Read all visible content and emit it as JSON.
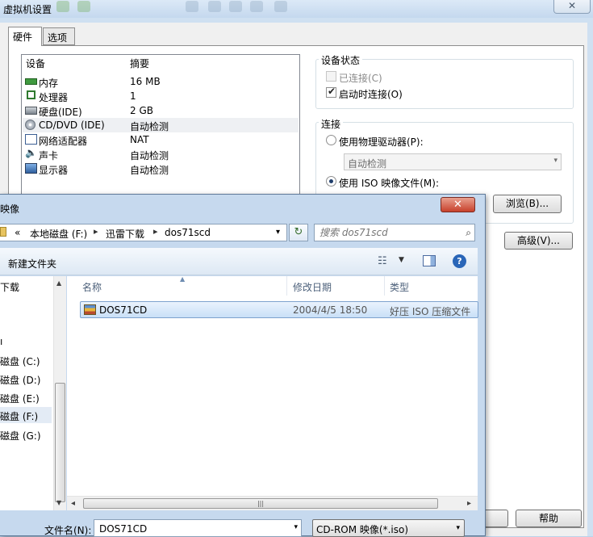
{
  "vm_window": {
    "title": "虚拟机设置",
    "close_glyph": "✕",
    "tabs": [
      {
        "label": "硬件"
      },
      {
        "label": "选项"
      }
    ],
    "device_list": {
      "headers": {
        "device": "设备",
        "summary": "摘要"
      },
      "rows": [
        {
          "name": "内存",
          "summary": "16 MB",
          "icon": "memory-icon"
        },
        {
          "name": "处理器",
          "summary": "1",
          "icon": "processor-icon"
        },
        {
          "name": "硬盘(IDE)",
          "summary": "2 GB",
          "icon": "harddisk-icon"
        },
        {
          "name": "CD/DVD (IDE)",
          "summary": "自动检测",
          "icon": "cdrom-icon"
        },
        {
          "name": "网络适配器",
          "summary": "NAT",
          "icon": "network-icon"
        },
        {
          "name": "声卡",
          "summary": "自动检测",
          "icon": "speaker-icon"
        },
        {
          "name": "显示器",
          "summary": "自动检测",
          "icon": "monitor-icon"
        }
      ]
    },
    "device_status": {
      "title": "设备状态",
      "connected_label": "已连接(C)",
      "connect_at_power_on_label": "启动时连接(O)",
      "checkmark": "✔"
    },
    "connection": {
      "title": "连接",
      "physical_drive_label": "使用物理驱动器(P):",
      "physical_drive_value": "自动检测",
      "iso_label": "使用 ISO 映像文件(M):",
      "browse_label": "浏览(B)...",
      "advanced_label": "高级(V)..."
    },
    "help_label": "帮助"
  },
  "file_dialog": {
    "title": "映像",
    "close_glyph": "✕",
    "breadcrumb": {
      "back": "«",
      "items": [
        "本地磁盘 (F:)",
        "迅雷下载",
        "dos71scd"
      ],
      "separator": "▸",
      "dropdown": "▾",
      "refresh": "↻"
    },
    "search": {
      "placeholder": "搜索 dos71scd",
      "icon": "⌕"
    },
    "toolbar": {
      "new_folder_label": "新建文件夹",
      "view_glyph": "☷",
      "view_dropdown": "▼",
      "help_glyph": "?"
    },
    "nav_pane": {
      "items": [
        {
          "label": "下载",
          "selected": false
        },
        {
          "label": "ı",
          "selected": false
        },
        {
          "label": "磁盘 (C:)",
          "selected": false
        },
        {
          "label": "磁盘 (D:)",
          "selected": false
        },
        {
          "label": "磁盘 (E:)",
          "selected": false
        },
        {
          "label": "磁盘 (F:)",
          "selected": true
        },
        {
          "label": "磁盘 (G:)",
          "selected": false
        }
      ],
      "scroll_up": "▲",
      "scroll_down": "▼"
    },
    "columns": {
      "name": "名称",
      "date": "修改日期",
      "type": "类型",
      "sort_arrow": "▲"
    },
    "files": [
      {
        "name": "DOS71CD",
        "date": "2004/4/5 18:50",
        "type": "好压 ISO 压缩文件"
      }
    ],
    "h_scroll": {
      "left": "◂",
      "right": "▸",
      "grip": "|||"
    },
    "filename": {
      "label": "文件名(N):",
      "value": "DOS71CD",
      "dropdown": "▾"
    },
    "filter": {
      "value": "CD-ROM 映像(*.iso)",
      "dropdown": "▾"
    }
  }
}
